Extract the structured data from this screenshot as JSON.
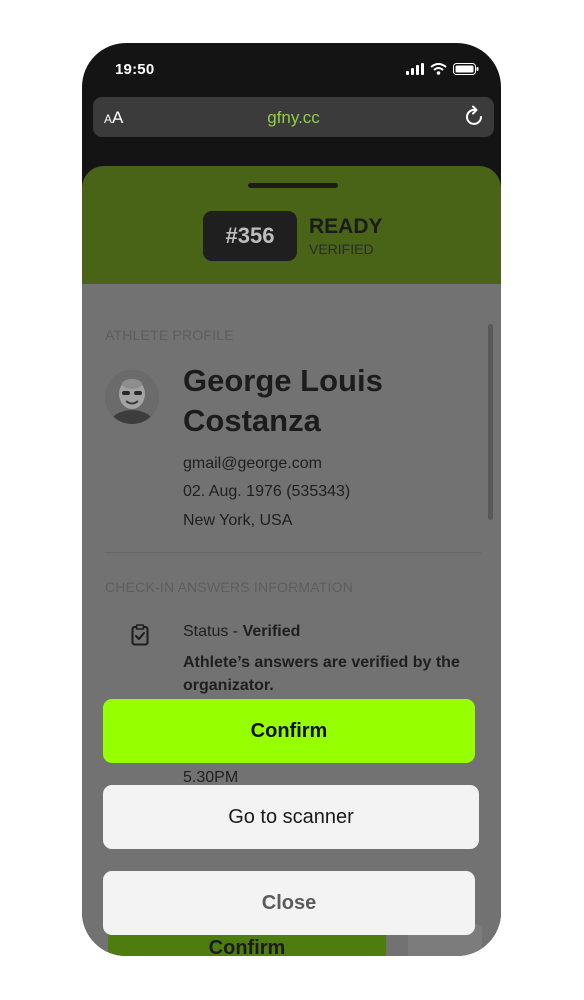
{
  "status_bar": {
    "time": "19:50",
    "icons": [
      "signal-icon",
      "wifi-icon",
      "battery-icon"
    ]
  },
  "browser": {
    "text_size_small": "A",
    "text_size_large": "A",
    "url": "gfny.cc"
  },
  "ticket": {
    "number": "#356",
    "state": "READY",
    "substate": "VERIFIED"
  },
  "athlete_profile": {
    "section_label": "ATHLETE PROFILE",
    "name": "George Louis Costanza",
    "email": "gmail@george.com",
    "birth": "02. Aug. 1976 (535343)",
    "location": "New York, USA"
  },
  "checkin": {
    "section_label": "CHECK-IN ANSWERS INFORMATION",
    "status_prefix": "Status - ",
    "status_value": "Verified",
    "description": "Athlete’s answers are verified by the organizator.",
    "time": "5.30PM"
  },
  "background_confirm": "Confirm",
  "actions": {
    "confirm": "Confirm",
    "scanner": "Go to scanner",
    "close": "Close"
  },
  "colors": {
    "accent": "#96ff00",
    "header_green": "#4a6417",
    "url_green": "#8fce4a"
  }
}
